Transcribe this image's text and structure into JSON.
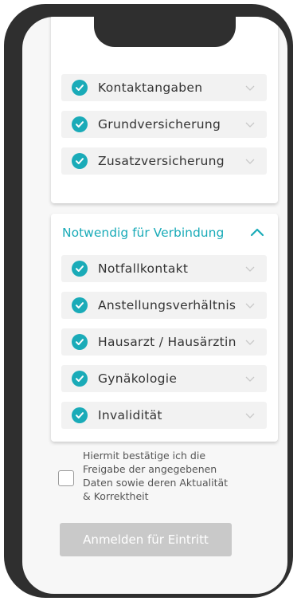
{
  "colors": {
    "accent": "#1aabb8",
    "frame": "#2f2f2f",
    "disabled_button": "#c9c9c9"
  },
  "top_card": {
    "items": [
      {
        "label": "Kontaktangaben",
        "checked": true
      },
      {
        "label": "Grundversicherung",
        "checked": true
      },
      {
        "label": "Zusatzversicherung",
        "checked": true
      }
    ]
  },
  "connection_section": {
    "title": "Notwendig für Verbindung",
    "expanded": true,
    "items": [
      {
        "label": "Notfallkontakt",
        "checked": true
      },
      {
        "label": "Anstellungsverhältnis",
        "checked": true
      },
      {
        "label": "Hausarzt / Hausärztin",
        "checked": true
      },
      {
        "label": "Gynäkologie",
        "checked": true
      },
      {
        "label": "Invalidität",
        "checked": true
      }
    ]
  },
  "consent": {
    "line1": "Hiermit bestätige ich die",
    "line2": "Freigabe der angegebenen",
    "line3": "Daten sowie deren Aktualität",
    "line4": "& Korrektheit",
    "checked": false
  },
  "submit": {
    "label": "Anmelden für Eintritt",
    "enabled": false
  },
  "icons": {
    "check": "check-icon",
    "chevron": "chevron-down-icon",
    "collapse": "chevron-up-icon"
  }
}
